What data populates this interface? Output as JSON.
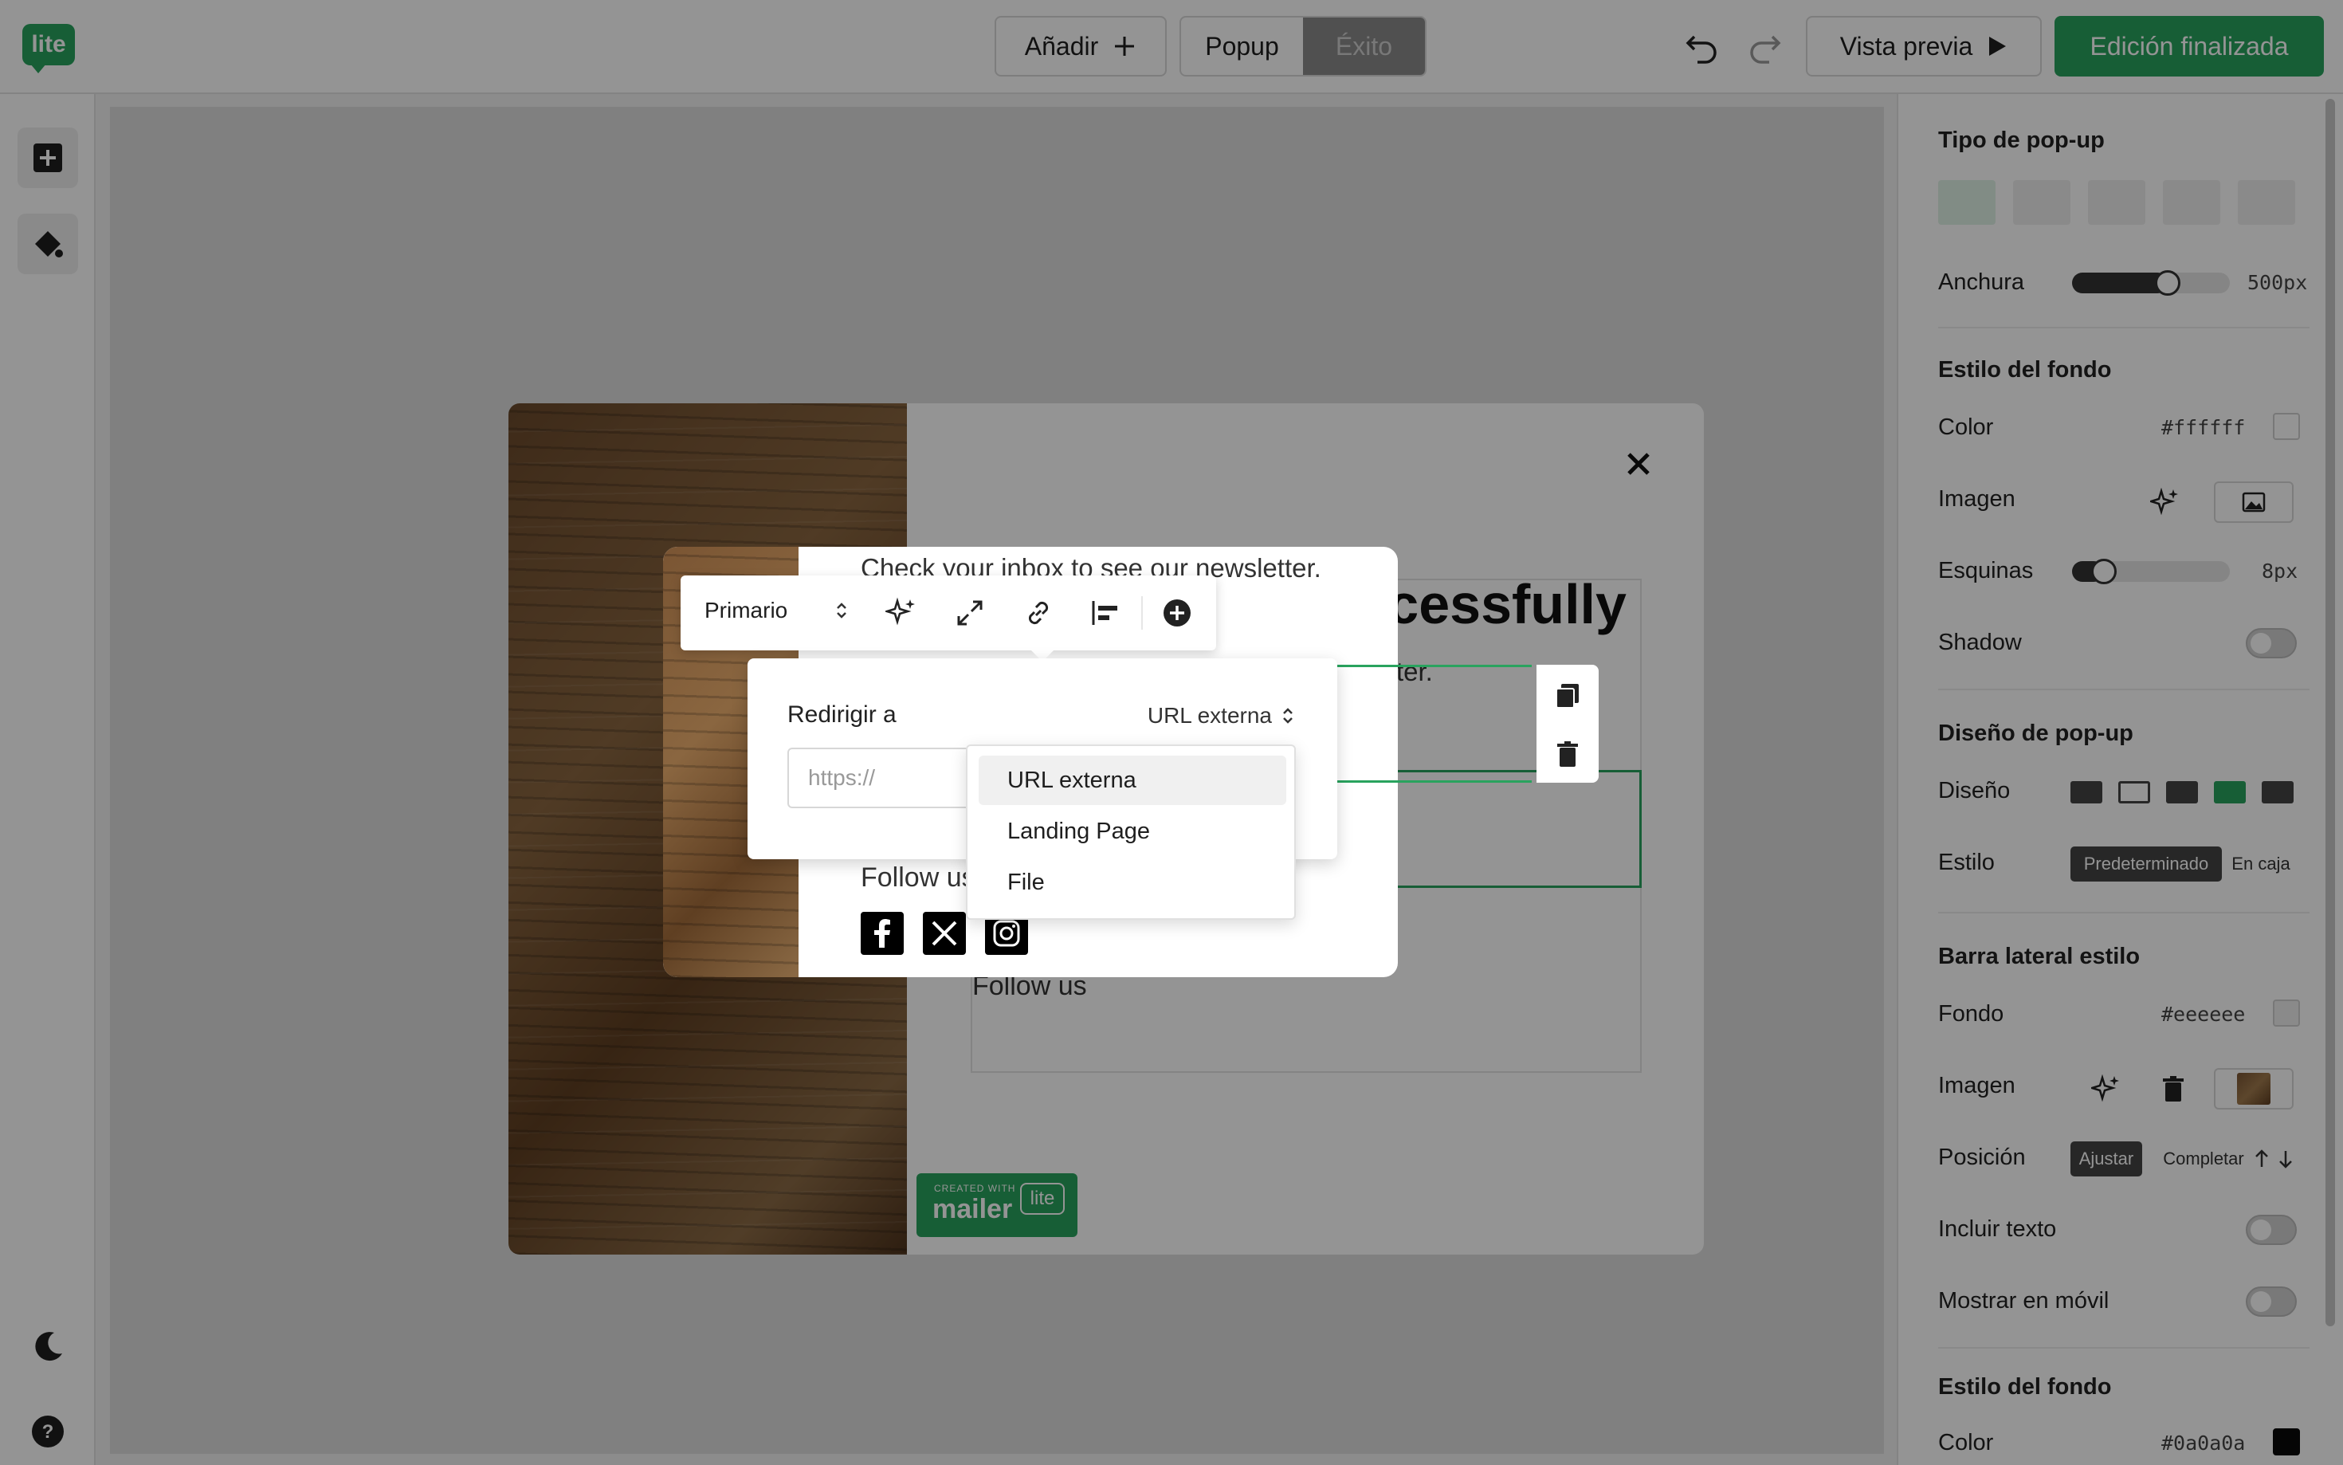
{
  "topbar": {
    "logo": "lite",
    "add_label": "Añadir",
    "views": [
      "Popup",
      "Éxito"
    ],
    "active_view": "Éxito",
    "preview_label": "Vista previa",
    "finish_label": "Edición finalizada"
  },
  "popup": {
    "heading": "Subscribed successfully",
    "subtext": "Check your inbox to see our newsletter.",
    "follow_text": "Follow us",
    "badge_small": "CREATED WITH",
    "badge_big": "mailer",
    "badge_lite": "lite"
  },
  "toolbar": {
    "style_select": "Primario"
  },
  "redirect": {
    "label": "Redirigir a",
    "type_value": "URL externa",
    "url_placeholder": "https://",
    "options": [
      "URL externa",
      "Landing Page",
      "File"
    ],
    "selected_option": "URL externa"
  },
  "panel": {
    "popup_type_title": "Tipo de pop-up",
    "width_label": "Anchura",
    "width_value": "500px",
    "width_level": 0.6,
    "bg_style_title": "Estilo del fondo",
    "color_label": "Color",
    "color_value": "#ffffff",
    "image_label": "Imagen",
    "corners_label": "Esquinas",
    "corners_value": "8px",
    "corners_level": 0.15,
    "shadow_label": "Shadow",
    "design_title": "Diseño de pop-up",
    "layout_label": "Diseño",
    "style_label": "Estilo",
    "style_options": [
      "Predeterminado",
      "En caja"
    ],
    "sidebar_title": "Barra lateral estilo",
    "sidebar_bg_label": "Fondo",
    "sidebar_bg_value": "#eeeeee",
    "sidebar_image_label": "Imagen",
    "position_label": "Posición",
    "position_options": [
      "Ajustar",
      "Completar"
    ],
    "include_text_label": "Incluir texto",
    "mobile_label": "Mostrar en móvil",
    "bg_style_title_2": "Estilo del fondo",
    "color_label_2": "Color",
    "color_value_2": "#0a0a0a"
  },
  "colors": {
    "accent": "#29a35e"
  }
}
